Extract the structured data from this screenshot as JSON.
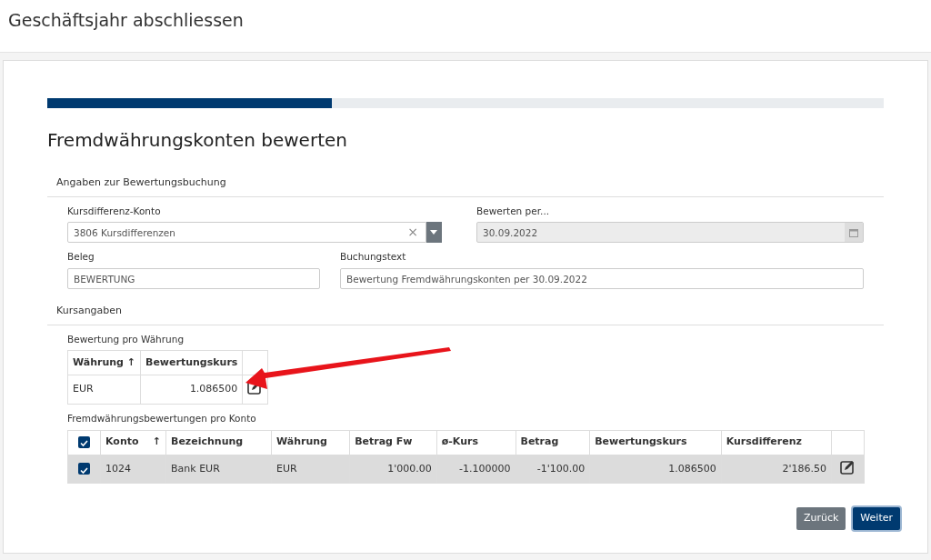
{
  "page_title": "Geschäftsjahr abschliessen",
  "progress": {
    "level": 0.34
  },
  "heading": "Fremdwährungskonten bewerten",
  "booking": {
    "title": "Angaben zur Bewertungsbuchung",
    "account": {
      "label": "Kursdifferenz-Konto",
      "value": "3806 Kursdifferenzen",
      "clear": "×"
    },
    "date": {
      "label": "Bewerten per...",
      "value": "30.09.2022",
      "disabled": true
    },
    "receipt": {
      "label": "Beleg",
      "value": "BEWERTUNG"
    },
    "text": {
      "label": "Buchungstext",
      "value": "Bewertung Fremdwährungskonten per 30.09.2022"
    }
  },
  "rates": {
    "title": "Kursangaben",
    "currency_table": {
      "title": "Bewertung pro Währung",
      "columns": [
        "Währung ↑",
        "Bewertungskurs"
      ],
      "rows": [
        {
          "cells": [
            "EUR",
            "1.086500"
          ]
        }
      ]
    },
    "account_table": {
      "title": "Fremdwährungsbewertungen pro Konto",
      "all_checked": true,
      "sort_arrow": "↑",
      "columns": [
        "Konto",
        "Bezeichnung",
        "Währung",
        "Betrag Fw",
        "ø-Kurs",
        "Betrag",
        "Bewertungskurs",
        "Kursdifferenz"
      ],
      "rows": [
        {
          "checked": true,
          "selected": true,
          "cells": [
            "1024",
            "Bank EUR",
            "EUR",
            "1'000.00",
            "-1.100000",
            "-1'100.00",
            "1.086500",
            "2'186.50"
          ]
        }
      ]
    }
  },
  "buttons": [
    {
      "label": "Zurück",
      "kind": "secondary"
    },
    {
      "label": "Weiter",
      "kind": "primary"
    }
  ]
}
